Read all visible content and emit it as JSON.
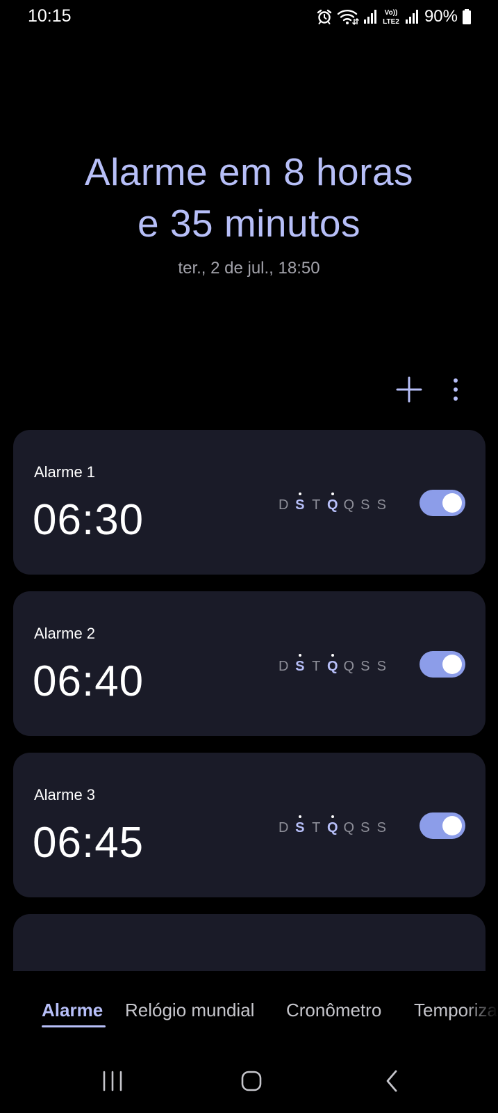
{
  "status_bar": {
    "time": "10:15",
    "battery": "90%",
    "icons": [
      "alarm-icon",
      "wifi-icon",
      "signal-icon",
      "volte-lte2-icon",
      "signal-icon",
      "battery-icon"
    ],
    "volte_label_top": "Vo))",
    "volte_label_bottom": "LTE2"
  },
  "header": {
    "line1": "Alarme em 8 horas",
    "line2": "e 35 minutos",
    "next_alarm": "ter., 2 de jul., 18:50"
  },
  "toolbar": {
    "add_icon": "plus-icon",
    "more_icon": "more-vertical-icon"
  },
  "alarms": [
    {
      "name": "Alarme 1",
      "time": "06:30",
      "days": [
        "D",
        "S",
        "T",
        "Q",
        "Q",
        "S",
        "S"
      ],
      "active_days": [
        1,
        3
      ],
      "enabled": true
    },
    {
      "name": "Alarme 2",
      "time": "06:40",
      "days": [
        "D",
        "S",
        "T",
        "Q",
        "Q",
        "S",
        "S"
      ],
      "active_days": [
        1,
        3
      ],
      "enabled": true
    },
    {
      "name": "Alarme 3",
      "time": "06:45",
      "days": [
        "D",
        "S",
        "T",
        "Q",
        "Q",
        "S",
        "S"
      ],
      "active_days": [
        1,
        3
      ],
      "enabled": true
    }
  ],
  "tabs": [
    {
      "label": "Alarme",
      "selected": true
    },
    {
      "label": "Relógio mundial",
      "selected": false
    },
    {
      "label": "Cronômetro",
      "selected": false
    },
    {
      "label": "Temporizador",
      "selected": false
    }
  ],
  "nav": {
    "recents_icon": "recents-icon",
    "home_icon": "home-icon",
    "back_icon": "back-icon"
  },
  "colors": {
    "accent": "#b7bff8",
    "toggle_on": "#8c9de9",
    "card": "#1a1b28",
    "background": "#000000"
  }
}
